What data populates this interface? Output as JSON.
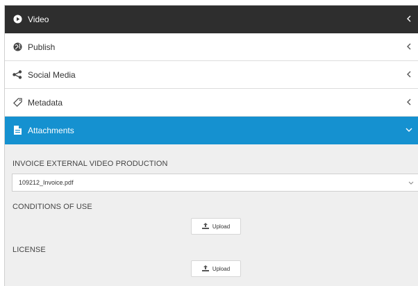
{
  "sections": [
    {
      "label": "Video",
      "icon": "play-circle-icon",
      "state": "collapsed"
    },
    {
      "label": "Publish",
      "icon": "globe-icon",
      "state": "collapsed"
    },
    {
      "label": "Social Media",
      "icon": "share-icon",
      "state": "collapsed"
    },
    {
      "label": "Metadata",
      "icon": "tag-icon",
      "state": "collapsed"
    },
    {
      "label": "Attachments",
      "icon": "file-icon",
      "state": "expanded"
    }
  ],
  "attachments": {
    "invoice": {
      "label": "INVOICE EXTERNAL VIDEO PRODUCTION",
      "value": "109212_Invoice.pdf"
    },
    "conditions": {
      "label": "CONDITIONS OF USE",
      "button_label": "Upload"
    },
    "license": {
      "label": "LICENSE",
      "button_label": "Upload"
    }
  },
  "colors": {
    "dark_header": "#2e2e2e",
    "active_header": "#1591d0",
    "content_bg": "#efefef"
  }
}
